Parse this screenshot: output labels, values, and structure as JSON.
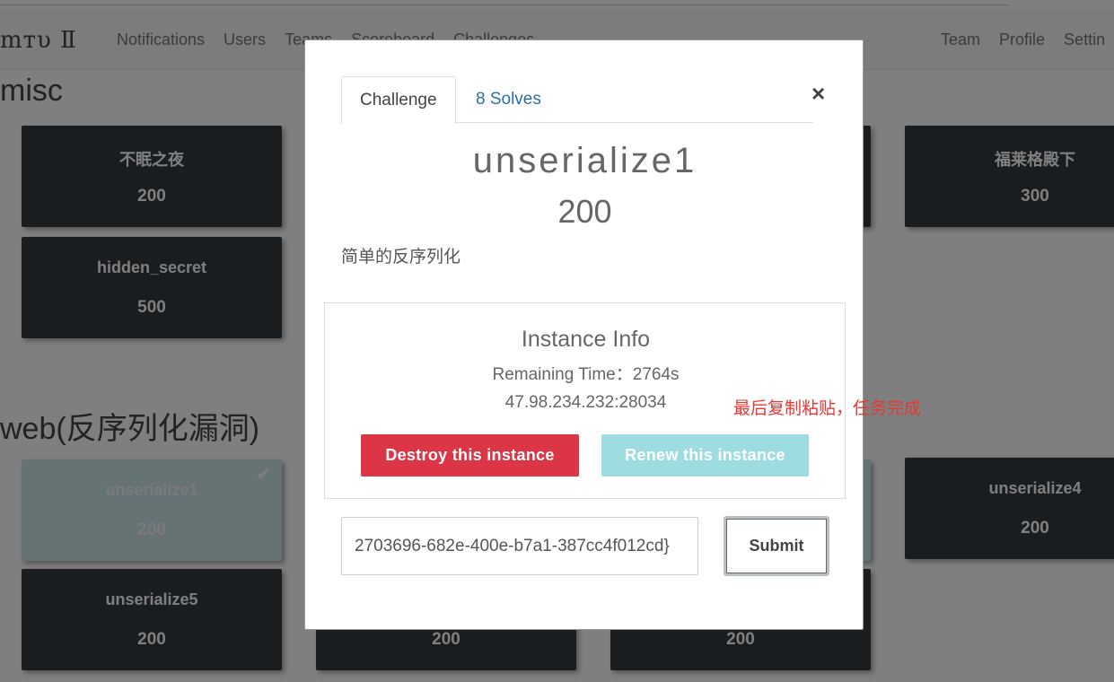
{
  "nav": {
    "brand": "mтυ Ⅱ",
    "left": [
      "Notifications",
      "Users",
      "Teams",
      "Scoreboard",
      "Challenges"
    ],
    "right": [
      "Team",
      "Profile",
      "Settin"
    ]
  },
  "categories": [
    {
      "title": "misc"
    },
    {
      "title": "web(反序列化漏洞)"
    }
  ],
  "cards": [
    {
      "name": "不眠之夜",
      "value": "200"
    },
    {
      "name": "福莱格殿下",
      "value": "300"
    },
    {
      "name": "hidden_secret",
      "value": "500"
    },
    {
      "name": "unserialize1",
      "value": "200",
      "solved": true
    },
    {
      "name": "unserialize4",
      "value": "200"
    },
    {
      "name": "unserialize5",
      "value": "200"
    },
    {
      "name": "",
      "value": "200"
    },
    {
      "name": "",
      "value": "200"
    }
  ],
  "modal": {
    "tabs": [
      "Challenge",
      "8 Solves"
    ],
    "close": "×",
    "title": "unserialize1",
    "value": "200",
    "description": "简单的反序列化",
    "instance": {
      "title": "Instance Info",
      "remaining": "Remaining Time：2764s",
      "address": "47.98.234.232:28034",
      "destroy_label": "Destroy this instance",
      "renew_label": "Renew this instance"
    },
    "flag_value": "2703696-682e-400e-b7a1-387cc4f012cd}",
    "submit_label": "Submit"
  },
  "annotation": "最后复制粘贴，任务完成",
  "colors": {
    "danger": "#dc3545",
    "info": "#9ddde2",
    "card_bg": "#343a40",
    "link": "#2a70a8",
    "annotation": "#e53935"
  }
}
